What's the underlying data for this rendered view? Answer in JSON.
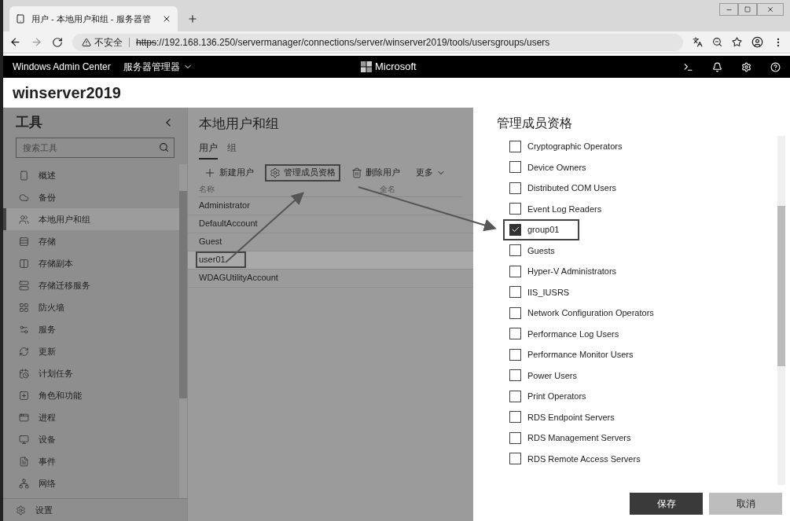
{
  "browser": {
    "tab_title": "用户 - 本地用户和组 - 服务器管",
    "url_warning": "不安全",
    "url_scheme": "https",
    "url_rest": "://192.168.136.250/servermanager/connections/server/winserver2019/tools/usersgroups/users"
  },
  "app_bar": {
    "brand": "Windows Admin Center",
    "menu": "服务器管理器",
    "logo_text": "Microsoft"
  },
  "server_title": "winserver2019",
  "sidebar": {
    "title": "工具",
    "search_placeholder": "搜索工具",
    "items": [
      {
        "label": "概述",
        "selected": false
      },
      {
        "label": "备份",
        "selected": false
      },
      {
        "label": "本地用户和组",
        "selected": true
      },
      {
        "label": "存储",
        "selected": false
      },
      {
        "label": "存储副本",
        "selected": false
      },
      {
        "label": "存储迁移服务",
        "selected": false
      },
      {
        "label": "防火墙",
        "selected": false
      },
      {
        "label": "服务",
        "selected": false
      },
      {
        "label": "更新",
        "selected": false
      },
      {
        "label": "计划任务",
        "selected": false
      },
      {
        "label": "角色和功能",
        "selected": false
      },
      {
        "label": "进程",
        "selected": false
      },
      {
        "label": "设备",
        "selected": false
      },
      {
        "label": "事件",
        "selected": false
      },
      {
        "label": "网络",
        "selected": false
      }
    ],
    "footer": "设置"
  },
  "main": {
    "title": "本地用户和组",
    "tabs": [
      {
        "label": "用户",
        "selected": true
      },
      {
        "label": "组",
        "selected": false
      }
    ],
    "toolbar": [
      {
        "label": "新建用户",
        "kind": "add",
        "highlighted": false
      },
      {
        "label": "管理成员资格",
        "kind": "gear",
        "highlighted": true
      },
      {
        "label": "删除用户",
        "kind": "trash",
        "highlighted": false
      },
      {
        "label": "更多",
        "kind": "more",
        "highlighted": false
      }
    ],
    "columns": [
      "名称",
      "全名"
    ],
    "rows": [
      {
        "name": "Administrator",
        "selected": false,
        "highlighted": false
      },
      {
        "name": "DefaultAccount",
        "selected": false,
        "highlighted": false
      },
      {
        "name": "Guest",
        "selected": false,
        "highlighted": false
      },
      {
        "name": "user01",
        "selected": true,
        "highlighted": true
      },
      {
        "name": "WDAGUtilityAccount",
        "selected": false,
        "highlighted": false
      }
    ]
  },
  "panel": {
    "title": "管理成员资格",
    "groups": [
      {
        "label": "Cryptographic Operators",
        "checked": false,
        "highlighted": false
      },
      {
        "label": "Device Owners",
        "checked": false,
        "highlighted": false
      },
      {
        "label": "Distributed COM Users",
        "checked": false,
        "highlighted": false
      },
      {
        "label": "Event Log Readers",
        "checked": false,
        "highlighted": false
      },
      {
        "label": "group01",
        "checked": true,
        "highlighted": true
      },
      {
        "label": "Guests",
        "checked": false,
        "highlighted": false
      },
      {
        "label": "Hyper-V Administrators",
        "checked": false,
        "highlighted": false
      },
      {
        "label": "IIS_IUSRS",
        "checked": false,
        "highlighted": false
      },
      {
        "label": "Network Configuration Operators",
        "checked": false,
        "highlighted": false
      },
      {
        "label": "Performance Log Users",
        "checked": false,
        "highlighted": false
      },
      {
        "label": "Performance Monitor Users",
        "checked": false,
        "highlighted": false
      },
      {
        "label": "Power Users",
        "checked": false,
        "highlighted": false
      },
      {
        "label": "Print Operators",
        "checked": false,
        "highlighted": false
      },
      {
        "label": "RDS Endpoint Servers",
        "checked": false,
        "highlighted": false
      },
      {
        "label": "RDS Management Servers",
        "checked": false,
        "highlighted": false
      },
      {
        "label": "RDS Remote Access Servers",
        "checked": false,
        "highlighted": false
      }
    ],
    "buttons": [
      {
        "label": "保存",
        "kind": "primary"
      },
      {
        "label": "取消",
        "kind": "secondary"
      }
    ]
  }
}
